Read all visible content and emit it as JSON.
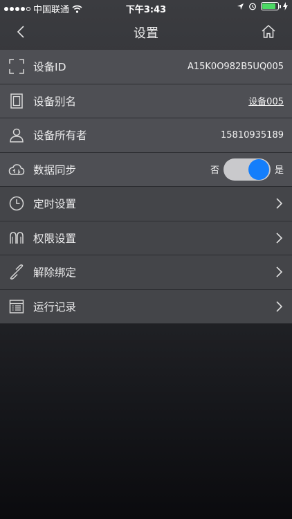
{
  "status_bar": {
    "carrier": "中国联通",
    "time": "下午3:43"
  },
  "nav": {
    "title": "设置"
  },
  "rows": [
    {
      "label": "设备ID",
      "value": "A15K0O982B5UQ005",
      "icon": "qr-scan-icon"
    },
    {
      "label": "设备别名",
      "value": "设备005",
      "icon": "device-icon"
    },
    {
      "label": "设备所有者",
      "value": "15810935189",
      "icon": "person-icon"
    },
    {
      "label": "数据同步",
      "off_label": "否",
      "on_label": "是",
      "toggle_on": true,
      "icon": "cloud-sync-icon"
    },
    {
      "label": "定时设置",
      "icon": "clock-icon"
    },
    {
      "label": "权限设置",
      "icon": "permission-icon"
    },
    {
      "label": "解除绑定",
      "icon": "unlink-icon"
    },
    {
      "label": "运行记录",
      "icon": "log-list-icon"
    }
  ],
  "colors": {
    "accent": "#147efb",
    "toggle_track": "#c9c9cc",
    "row_light": "#4e4f54",
    "row_dark": "#444549",
    "battery": "#4cd964"
  }
}
